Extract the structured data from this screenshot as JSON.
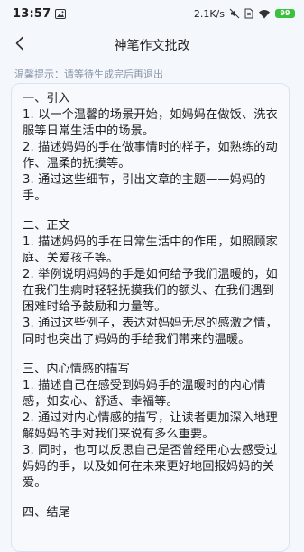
{
  "status": {
    "time": "13:57",
    "network_speed": "2.1K/s",
    "battery": "99"
  },
  "header": {
    "title": "神笔作文批改"
  },
  "tip": "温馨提示：请等待生成完后再退出",
  "content": {
    "sections": [
      {
        "heading": "一、引入",
        "items": [
          "1. 以一个温馨的场景开始，如妈妈在做饭、洗衣服等日常生活中的场景。",
          "2. 描述妈妈的手在做事情时的样子，如熟练的动作、温柔的抚摸等。",
          "3. 通过这些细节，引出文章的主题——妈妈的手。"
        ]
      },
      {
        "heading": "二、正文",
        "items": [
          "1. 描述妈妈的手在日常生活中的作用，如照顾家庭、关爱孩子等。",
          "2. 举例说明妈妈的手是如何给予我们温暖的，如在我们生病时轻轻抚摸我们的额头、在我们遇到困难时给予鼓励和力量等。",
          "3. 通过这些例子，表达对妈妈无尽的感激之情，同时也突出了妈妈的手给我们带来的温暖。"
        ]
      },
      {
        "heading": "三、内心情感的描写",
        "items": [
          "1. 描述自己在感受到妈妈手的温暖时的内心情感，如安心、舒适、幸福等。",
          "2. 通过对内心情感的描写，让读者更加深入地理解妈妈的手对我们来说有多么重要。",
          "3. 同时，也可以反思自己是否曾经用心去感受过妈妈的手，以及如何在未来更好地回报妈妈的关爱。"
        ]
      },
      {
        "heading": "四、结尾",
        "items": []
      }
    ]
  }
}
